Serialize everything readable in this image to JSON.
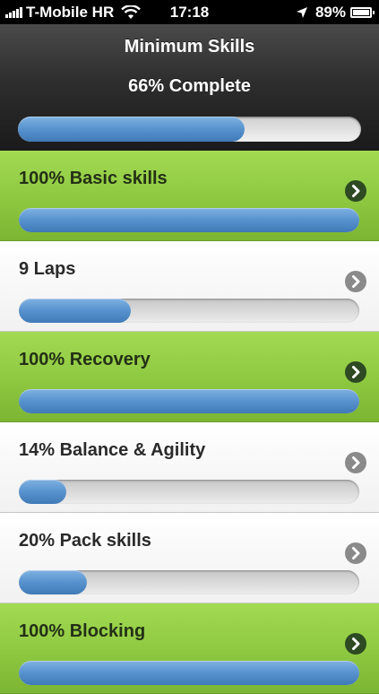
{
  "status_bar": {
    "carrier": "T-Mobile HR",
    "time": "17:18",
    "battery": "89%",
    "battery_level": 0.89,
    "icons": [
      "signal-bars-icon",
      "wifi-icon",
      "location-arrow-icon",
      "battery-icon"
    ]
  },
  "header": {
    "title": "Minimum Skills",
    "complete_text": "66% Complete",
    "progress": 0.66
  },
  "colors": {
    "complete_row": "#8cc63f",
    "progress_fill": "#5b95d0",
    "header_bg": "#2e2e2e"
  },
  "skills": [
    {
      "label": "100% Basic skills",
      "progress": 1.0,
      "complete": true
    },
    {
      "label": "9 Laps",
      "progress": 0.33,
      "complete": false
    },
    {
      "label": "100% Recovery",
      "progress": 1.0,
      "complete": true
    },
    {
      "label": "14% Balance & Agility",
      "progress": 0.14,
      "complete": false
    },
    {
      "label": "20% Pack skills",
      "progress": 0.2,
      "complete": false
    },
    {
      "label": "100% Blocking",
      "progress": 1.0,
      "complete": true
    }
  ]
}
